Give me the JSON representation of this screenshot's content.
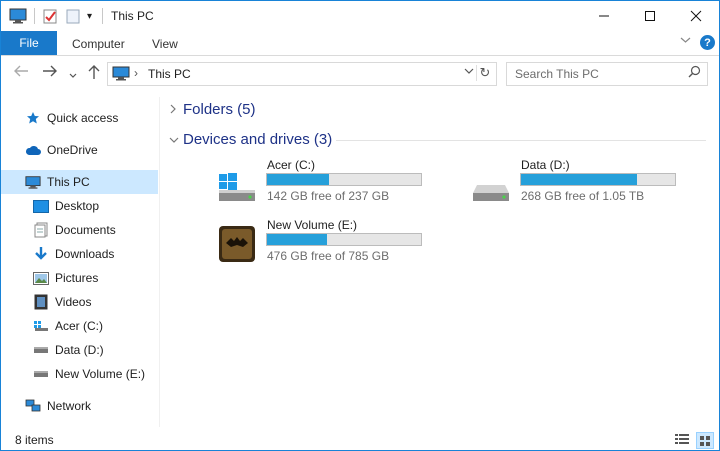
{
  "window": {
    "title": "This PC",
    "controls": [
      "minimize",
      "maximize",
      "close"
    ]
  },
  "ribbon": {
    "tabs": [
      "File",
      "Computer",
      "View"
    ],
    "help": "?"
  },
  "navigation": {
    "address": "This PC",
    "search_placeholder": "Search This PC"
  },
  "sidebar": {
    "items": [
      {
        "label": "Quick access",
        "icon": "star-icon"
      },
      {
        "label": "OneDrive",
        "icon": "cloud-icon"
      },
      {
        "label": "This PC",
        "icon": "computer-icon",
        "selected": true
      },
      {
        "label": "Desktop",
        "icon": "desktop-icon"
      },
      {
        "label": "Documents",
        "icon": "documents-icon"
      },
      {
        "label": "Downloads",
        "icon": "download-icon"
      },
      {
        "label": "Pictures",
        "icon": "pictures-icon"
      },
      {
        "label": "Videos",
        "icon": "videos-icon"
      },
      {
        "label": "Acer (C:)",
        "icon": "windows-drive-icon"
      },
      {
        "label": "Data (D:)",
        "icon": "drive-icon"
      },
      {
        "label": "New Volume (E:)",
        "icon": "drive-icon"
      },
      {
        "label": "Network",
        "icon": "network-icon"
      }
    ]
  },
  "content": {
    "groups": [
      {
        "label": "Folders (5)",
        "expanded": false
      },
      {
        "label": "Devices and drives (3)",
        "expanded": true
      }
    ],
    "drives": [
      {
        "name": "Acer (C:)",
        "free_text": "142 GB free of 237 GB",
        "used_fraction": 0.4,
        "icon": "windows-drive-icon"
      },
      {
        "name": "Data (D:)",
        "free_text": "268 GB free of 1.05 TB",
        "used_fraction": 0.75,
        "icon": "drive-icon"
      },
      {
        "name": "New Volume (E:)",
        "free_text": "476 GB free of 785 GB",
        "used_fraction": 0.39,
        "icon": "bat-drive-icon"
      }
    ]
  },
  "status": {
    "item_count": "8 items"
  },
  "colors": {
    "accent": "#1979ca",
    "selection": "#cce8ff",
    "bar_fill": "#26a0da",
    "group_text": "#1e3287"
  }
}
